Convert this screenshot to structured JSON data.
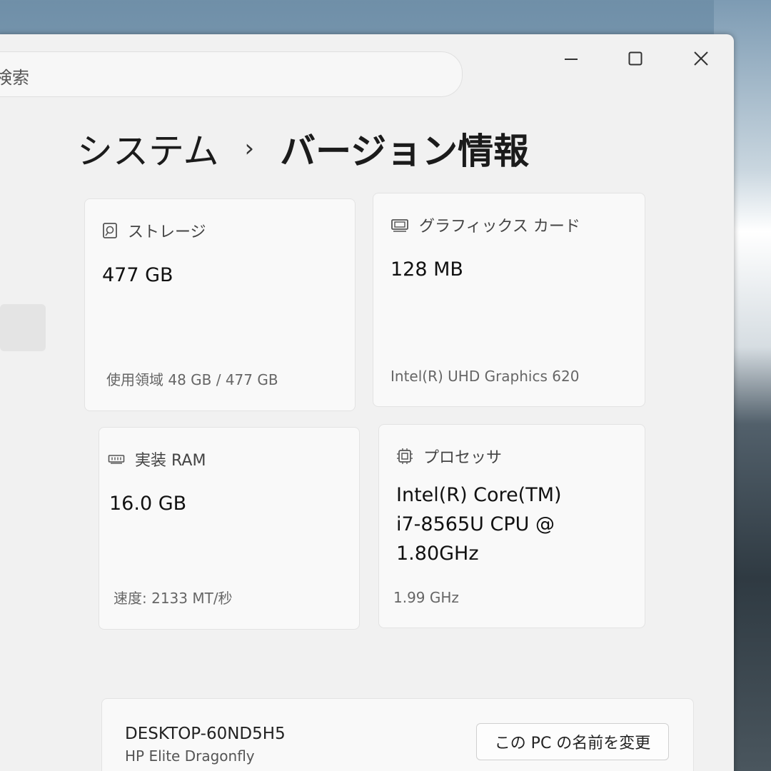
{
  "search": {
    "placeholder": "検索"
  },
  "breadcrumb": {
    "parent": "システム",
    "separator": "›",
    "current": "バージョン情報"
  },
  "cards": {
    "storage": {
      "label": "ストレージ",
      "value": "477 GB",
      "detail": "使用領域 48 GB / 477 GB",
      "icon": "hard-drive-icon"
    },
    "graphics": {
      "label": "グラフィックス カード",
      "value": "128 MB",
      "detail": "Intel(R) UHD Graphics 620",
      "icon": "display-adapter-icon"
    },
    "ram": {
      "label": "実装 RAM",
      "value": "16.0 GB",
      "detail": "速度: 2133 MT/秒",
      "icon": "memory-icon"
    },
    "processor": {
      "label": "プロセッサ",
      "value_lines": [
        "Intel(R) Core(TM)",
        "i7-8565U CPU @",
        "1.80GHz"
      ],
      "detail": "1.99 GHz",
      "icon": "processor-icon"
    }
  },
  "device": {
    "name": "DESKTOP-60ND5H5",
    "model": "HP Elite Dragonfly",
    "rename_button": "この PC の名前を変更"
  },
  "window_controls": {
    "minimize": "minimize-icon",
    "maximize": "maximize-icon",
    "close": "close-icon"
  },
  "colors": {
    "window_bg": "#f1f1f1",
    "card_bg": "#f9f9f9",
    "text_primary": "#111111",
    "text_secondary": "#666666"
  }
}
